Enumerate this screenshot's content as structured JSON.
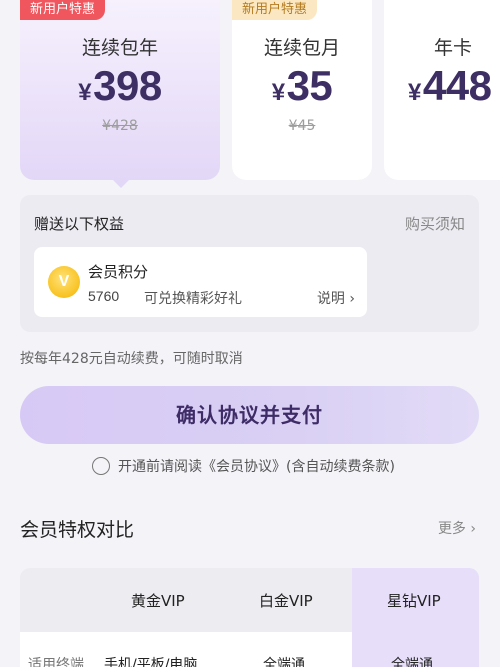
{
  "plans": [
    {
      "badge": "新用户特惠",
      "name": "连续包年",
      "currency": "¥",
      "price": "398",
      "original": "¥428"
    },
    {
      "badge": "新用户特惠",
      "name": "连续包月",
      "currency": "¥",
      "price": "35",
      "original": "¥45"
    },
    {
      "name": "年卡",
      "currency": "¥",
      "price": "448"
    }
  ],
  "benefits": {
    "title": "赠送以下权益",
    "notice": "购买须知",
    "item": {
      "icon": "v-coin-icon",
      "coin_letter": "V",
      "name": "会员积分",
      "value": "5760",
      "desc": "可兑换精彩好礼",
      "more": "说明 ›"
    }
  },
  "renew_text": "按每年428元自动续费，可随时取消",
  "pay_button": "确认协议并支付",
  "agreement": "开通前请阅读《会员协议》(含自动续费条款)",
  "compare": {
    "title": "会员特权对比",
    "more": "更多 ›",
    "columns": [
      "黄金VIP",
      "白金VIP",
      "星钻VIP"
    ],
    "rows": [
      {
        "label": "适用终端",
        "values": [
          "手机/平板/电脑",
          "全端通",
          "全端通"
        ]
      }
    ]
  },
  "colors": {
    "accent": "#3d2e63",
    "badge_red": "#f0565e",
    "badge_gold": "#fbe8c2",
    "highlight": "#e7defa"
  }
}
